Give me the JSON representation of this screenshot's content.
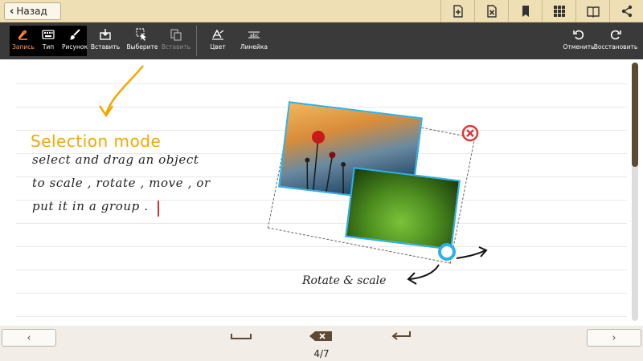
{
  "topbar": {
    "back_label": "Назад",
    "icons": [
      "add-page-icon",
      "delete-page-icon",
      "bookmark-icon",
      "grid-icon",
      "book-icon",
      "share-icon"
    ]
  },
  "toolbar": {
    "modes": [
      {
        "label": "Запись",
        "icon": "pen-icon"
      },
      {
        "label": "Тип",
        "icon": "keyboard-icon"
      },
      {
        "label": "Рисунок",
        "icon": "brush-icon"
      }
    ],
    "actions": [
      {
        "label": "Вставить",
        "icon": "insert-icon",
        "enabled": true
      },
      {
        "label": "Выберите",
        "icon": "select-icon",
        "enabled": true
      },
      {
        "label": "Вставить",
        "icon": "paste-icon",
        "enabled": false
      },
      {
        "label": "Цвет",
        "icon": "color-icon",
        "enabled": true
      },
      {
        "label": "Линейка",
        "icon": "ruler-icon",
        "enabled": true
      }
    ],
    "undo_label": "Отменить",
    "redo_label": "Восстановить"
  },
  "note": {
    "title": "Selection mode",
    "lines": [
      "select and drag an object",
      "to scale , rotate , move , or",
      "put it in a group ."
    ],
    "rotate_label": "Rotate & scale"
  },
  "colors": {
    "title": "#f0a800",
    "selection_border": "#2db0e8",
    "close": "#e03535",
    "toolbar": "#3a3a3a",
    "topbar": "#efdfb4"
  },
  "bottom": {
    "page_indicator": "4/7",
    "prev_label": "‹",
    "next_label": "›"
  }
}
